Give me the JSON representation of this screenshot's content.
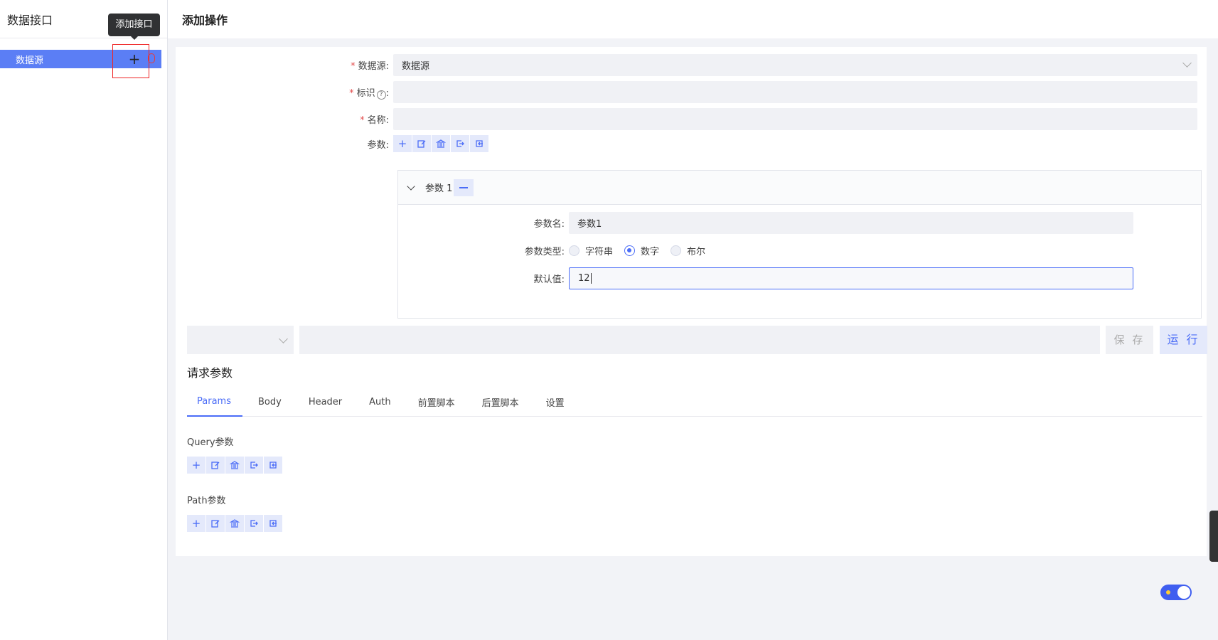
{
  "sidebar": {
    "title": "数据接口",
    "add_tooltip": "添加接口",
    "items": [
      {
        "label": "数据源"
      }
    ]
  },
  "main": {
    "title": "添加操作",
    "form": {
      "datasource_label": "数据源:",
      "datasource_value": "数据源",
      "identifier_label": "标识",
      "identifier_suffix": ":",
      "name_label": "名称:",
      "params_label": "参数:"
    },
    "param_panel": {
      "header": "参数 1",
      "param_name_label": "参数名:",
      "param_name_value": "参数1",
      "param_type_label": "参数类型:",
      "param_types": [
        "字符串",
        "数字",
        "布尔"
      ],
      "param_type_selected": "数字",
      "default_label": "默认值:",
      "default_value": "12"
    },
    "actions": {
      "save_label": "保 存",
      "run_label": "运 行"
    },
    "request": {
      "section_title": "请求参数",
      "tabs": [
        "Params",
        "Body",
        "Header",
        "Auth",
        "前置脚本",
        "后置脚本",
        "设置"
      ],
      "active_tab": "Params",
      "query_title": "Query参数",
      "path_title": "Path参数"
    }
  },
  "colors": {
    "accent": "#4a6cf7",
    "sidebar_active": "#5b7ef5",
    "required": "#e34d4d",
    "highlight": "#ef2424"
  },
  "icons": [
    "plus-icon",
    "edit-icon",
    "bank-icon",
    "export-icon",
    "import-icon",
    "chevron-down-icon",
    "help-icon",
    "minus-icon"
  ]
}
